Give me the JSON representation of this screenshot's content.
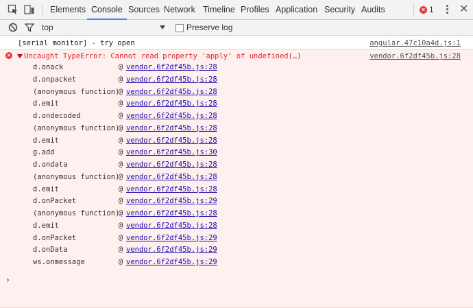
{
  "tabs": [
    {
      "label": "Elements"
    },
    {
      "label": "Console"
    },
    {
      "label": "Sources"
    },
    {
      "label": "Network"
    },
    {
      "label": "Timeline"
    },
    {
      "label": "Profiles"
    },
    {
      "label": "Application"
    },
    {
      "label": "Security"
    },
    {
      "label": "Audits"
    }
  ],
  "error_badge": {
    "count": "1"
  },
  "filter": {
    "context": "top",
    "preserve_log_label": "Preserve log"
  },
  "log_message": {
    "text": "[serial monitor] - try open",
    "source": "angular.47c10a4d.js:1"
  },
  "error_message": {
    "text": "Uncaught TypeError: Cannot read property 'apply' of undefined(…)",
    "source": "vendor.6f2df45b.js:28",
    "stack": [
      {
        "fn": "d.onack",
        "at": "@",
        "loc": "vendor.6f2df45b.js:28"
      },
      {
        "fn": "d.onpacket",
        "at": "@",
        "loc": "vendor.6f2df45b.js:28"
      },
      {
        "fn": "(anonymous function)",
        "at": "@",
        "loc": "vendor.6f2df45b.js:28"
      },
      {
        "fn": "d.emit",
        "at": "@",
        "loc": "vendor.6f2df45b.js:28"
      },
      {
        "fn": "d.ondecoded",
        "at": "@",
        "loc": "vendor.6f2df45b.js:28"
      },
      {
        "fn": "(anonymous function)",
        "at": "@",
        "loc": "vendor.6f2df45b.js:28"
      },
      {
        "fn": "d.emit",
        "at": "@",
        "loc": "vendor.6f2df45b.js:28"
      },
      {
        "fn": "g.add",
        "at": "@",
        "loc": "vendor.6f2df45b.js:30"
      },
      {
        "fn": "d.ondata",
        "at": "@",
        "loc": "vendor.6f2df45b.js:28"
      },
      {
        "fn": "(anonymous function)",
        "at": "@",
        "loc": "vendor.6f2df45b.js:28"
      },
      {
        "fn": "d.emit",
        "at": "@",
        "loc": "vendor.6f2df45b.js:28"
      },
      {
        "fn": "d.onPacket",
        "at": "@",
        "loc": "vendor.6f2df45b.js:29"
      },
      {
        "fn": "(anonymous function)",
        "at": "@",
        "loc": "vendor.6f2df45b.js:28"
      },
      {
        "fn": "d.emit",
        "at": "@",
        "loc": "vendor.6f2df45b.js:28"
      },
      {
        "fn": "d.onPacket",
        "at": "@",
        "loc": "vendor.6f2df45b.js:29"
      },
      {
        "fn": "d.onData",
        "at": "@",
        "loc": "vendor.6f2df45b.js:29"
      },
      {
        "fn": "ws.onmessage",
        "at": "@",
        "loc": "vendor.6f2df45b.js:29"
      }
    ]
  },
  "prompt": {
    "symbol": "›"
  },
  "colors": {
    "accent": "#3e82f7",
    "error": "#e02020",
    "error_bg": "#fff0f0"
  }
}
